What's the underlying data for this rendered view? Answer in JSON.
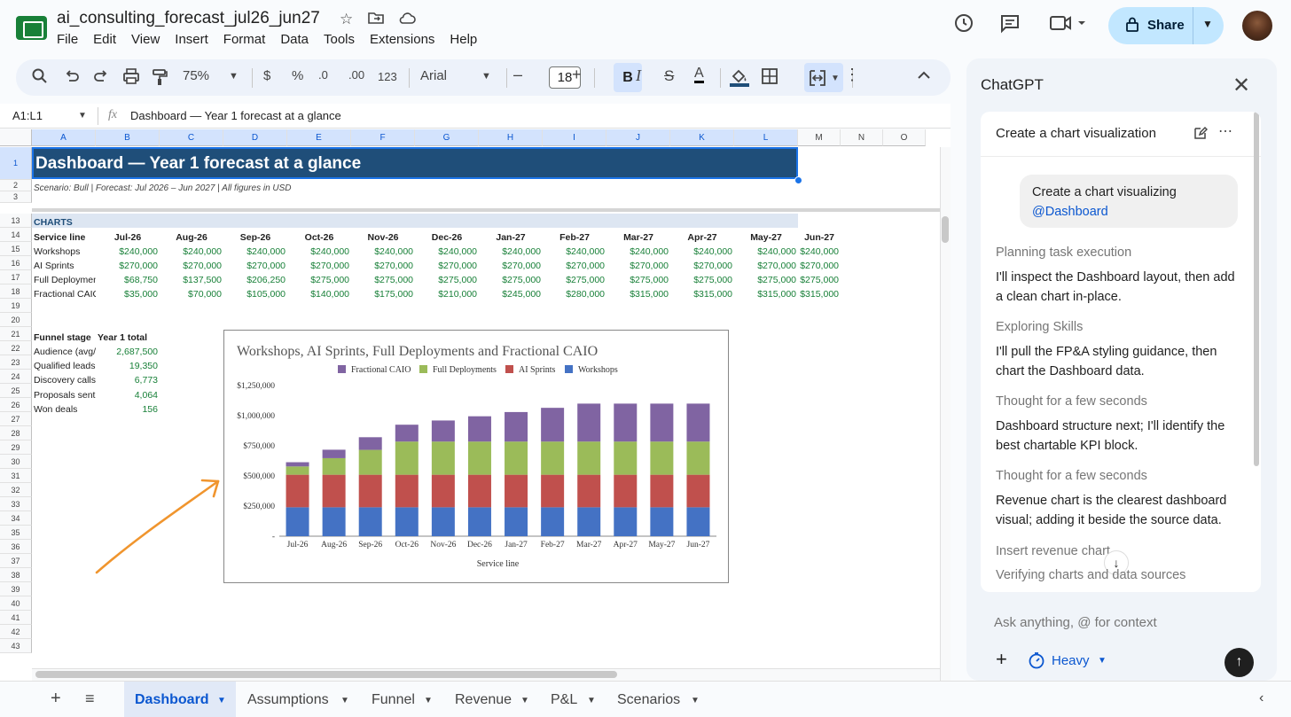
{
  "title": {
    "name": "ai_consulting_forecast_jul26_jun27"
  },
  "menu": [
    "File",
    "Edit",
    "View",
    "Insert",
    "Format",
    "Data",
    "Tools",
    "Extensions",
    "Help"
  ],
  "share": {
    "label": "Share"
  },
  "toolbar": {
    "zoom": "75%",
    "currency": "$",
    "percent": "%",
    "dec_minus": ".0",
    "dec_plus": ".00",
    "format123": "123",
    "font": "Arial",
    "font_size": "18",
    "bold": "B",
    "italic": "I",
    "strike": "S",
    "textcolor": "A"
  },
  "formula": {
    "namebox": "A1:L1",
    "fx": "fx",
    "content": "Dashboard  —  Year 1 forecast at a glance"
  },
  "columns": [
    "A",
    "B",
    "C",
    "D",
    "E",
    "F",
    "G",
    "H",
    "I",
    "J",
    "K",
    "L",
    "M",
    "N",
    "O"
  ],
  "rows": [
    "1",
    "2",
    "3",
    "13",
    "14",
    "15",
    "16",
    "17",
    "18",
    "19",
    "20",
    "21",
    "22",
    "23",
    "24",
    "25",
    "26",
    "27",
    "28",
    "29",
    "30",
    "31",
    "32",
    "33",
    "34",
    "35",
    "36",
    "37",
    "38",
    "39",
    "40",
    "41",
    "42",
    "43"
  ],
  "sheet": {
    "header": "Dashboard  —  Year 1 forecast at a glance",
    "subheader": "Scenario: Bull   |   Forecast: Jul 2026 – Jun 2027   |   All figures in USD",
    "charts_label": "CHARTS",
    "service_line_label": "Service line",
    "months": [
      "Jul-26",
      "Aug-26",
      "Sep-26",
      "Oct-26",
      "Nov-26",
      "Dec-26",
      "Jan-27",
      "Feb-27",
      "Mar-27",
      "Apr-27",
      "May-27",
      "Jun-27"
    ],
    "service_rows": [
      {
        "name": "Workshops",
        "values": [
          "$240,000",
          "$240,000",
          "$240,000",
          "$240,000",
          "$240,000",
          "$240,000",
          "$240,000",
          "$240,000",
          "$240,000",
          "$240,000",
          "$240,000",
          "$240,000"
        ]
      },
      {
        "name": "AI Sprints",
        "values": [
          "$270,000",
          "$270,000",
          "$270,000",
          "$270,000",
          "$270,000",
          "$270,000",
          "$270,000",
          "$270,000",
          "$270,000",
          "$270,000",
          "$270,000",
          "$270,000"
        ]
      },
      {
        "name": "Full Deployments",
        "values": [
          "$68,750",
          "$137,500",
          "$206,250",
          "$275,000",
          "$275,000",
          "$275,000",
          "$275,000",
          "$275,000",
          "$275,000",
          "$275,000",
          "$275,000",
          "$275,000"
        ]
      },
      {
        "name": "Fractional CAIO",
        "values": [
          "$35,000",
          "$70,000",
          "$105,000",
          "$140,000",
          "$175,000",
          "$210,000",
          "$245,000",
          "$280,000",
          "$315,000",
          "$315,000",
          "$315,000",
          "$315,000"
        ]
      }
    ],
    "funnel_label": "Funnel stage",
    "funnel_total_label": "Year 1 total",
    "funnel_rows": [
      {
        "name": "Audience (avg/",
        "value": "2,687,500"
      },
      {
        "name": "Qualified leads",
        "value": "19,350"
      },
      {
        "name": "Discovery calls",
        "value": "6,773"
      },
      {
        "name": "Proposals sent",
        "value": "4,064"
      },
      {
        "name": "Won deals",
        "value": "156"
      }
    ]
  },
  "chart_data": {
    "type": "bar",
    "stacked": true,
    "title": "Workshops, AI Sprints, Full Deployments and Fractional CAIO",
    "xlabel": "Service line",
    "ylabel": "",
    "ylim": [
      0,
      1250000
    ],
    "yticks": [
      "$1,250,000",
      "$1,000,000",
      "$750,000",
      "$500,000",
      "$250,000",
      "-"
    ],
    "legend_position": "top",
    "categories": [
      "Jul-26",
      "Aug-26",
      "Sep-26",
      "Oct-26",
      "Nov-26",
      "Dec-26",
      "Jan-27",
      "Feb-27",
      "Mar-27",
      "Apr-27",
      "May-27",
      "Jun-27"
    ],
    "series": [
      {
        "name": "Workshops",
        "color": "#4472c4",
        "values": [
          240000,
          240000,
          240000,
          240000,
          240000,
          240000,
          240000,
          240000,
          240000,
          240000,
          240000,
          240000
        ]
      },
      {
        "name": "AI Sprints",
        "color": "#c0504d",
        "values": [
          270000,
          270000,
          270000,
          270000,
          270000,
          270000,
          270000,
          270000,
          270000,
          270000,
          270000,
          270000
        ]
      },
      {
        "name": "Full Deployments",
        "color": "#9bbb59",
        "values": [
          68750,
          137500,
          206250,
          275000,
          275000,
          275000,
          275000,
          275000,
          275000,
          275000,
          275000,
          275000
        ]
      },
      {
        "name": "Fractional CAIO",
        "color": "#8064a2",
        "values": [
          35000,
          70000,
          105000,
          140000,
          175000,
          210000,
          245000,
          280000,
          315000,
          315000,
          315000,
          315000
        ]
      }
    ],
    "legend_order": [
      "Fractional CAIO",
      "Full Deployments",
      "AI Sprints",
      "Workshops"
    ]
  },
  "panel": {
    "title": "ChatGPT",
    "card_title": "Create a chart visualization",
    "user_msg_line1": "Create a chart visualizing",
    "user_msg_mention": "@Dashboard",
    "steps": [
      {
        "label": "Planning task execution",
        "text": "I'll inspect the Dashboard layout, then add a clean chart in-place."
      },
      {
        "label": "Exploring Skills",
        "text": "I'll pull the FP&A styling guidance, then chart the Dashboard data."
      },
      {
        "label": "Thought for a few seconds",
        "text": "Dashboard structure next; I'll identify the best chartable KPI block."
      },
      {
        "label": "Thought for a few seconds",
        "text": "Revenue chart is the clearest dashboard visual; adding it beside the source data."
      }
    ],
    "pending1": "Insert revenue chart",
    "pending2": "Verifying charts and data sources",
    "input_placeholder": "Ask anything, @ for context",
    "mode": "Heavy"
  },
  "tabs": [
    "Dashboard",
    "Assumptions",
    "Funnel",
    "Revenue",
    "P&L",
    "Scenarios"
  ],
  "colors": {
    "accent": "#0b57d0",
    "header_fill": "#1f4e79",
    "money_green": "#188038",
    "arrow": "#f0952e"
  }
}
